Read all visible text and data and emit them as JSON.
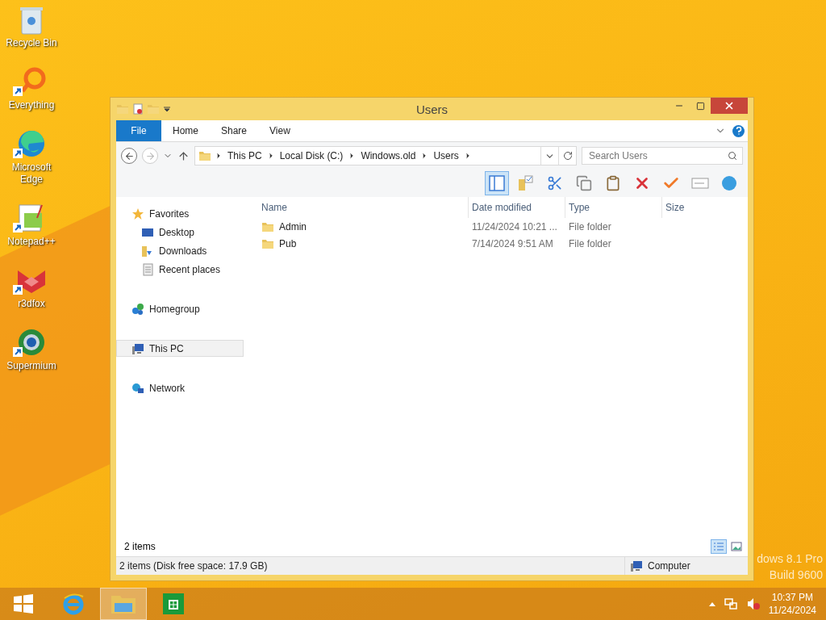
{
  "desktop_icons": [
    {
      "label": "Recycle Bin",
      "kind": "recycle",
      "shortcut": false
    },
    {
      "label": "Everything",
      "kind": "everything",
      "shortcut": true
    },
    {
      "label": "Microsoft Edge",
      "kind": "edge",
      "shortcut": true
    },
    {
      "label": "Notepad++",
      "kind": "notepad",
      "shortcut": true
    },
    {
      "label": "r3dfox",
      "kind": "fox",
      "shortcut": true
    },
    {
      "label": "Supermium",
      "kind": "supermium",
      "shortcut": true
    }
  ],
  "watermark": [
    "dows 8.1 Pro",
    "Build 9600"
  ],
  "window": {
    "title": "Users",
    "ribbon_tabs": [
      {
        "label": "File",
        "kind": "file",
        "selected": false
      },
      {
        "label": "Home",
        "kind": "tab",
        "selected": false
      },
      {
        "label": "Share",
        "kind": "tab",
        "selected": false
      },
      {
        "label": "View",
        "kind": "tab",
        "selected": false
      }
    ],
    "address": {
      "segments": [
        "This PC",
        "Local Disk (C:)",
        "Windows.old",
        "Users"
      ],
      "search_placeholder": "Search Users"
    },
    "toolbar": [
      {
        "kind": "pane",
        "selected": true
      },
      {
        "kind": "folder-check",
        "selected": false
      },
      {
        "kind": "cut",
        "selected": false
      },
      {
        "kind": "copy",
        "selected": false
      },
      {
        "kind": "paste",
        "selected": false
      },
      {
        "kind": "delete",
        "selected": false
      },
      {
        "kind": "check",
        "selected": false
      },
      {
        "kind": "rename",
        "selected": false
      },
      {
        "kind": "globe",
        "selected": false
      }
    ],
    "nav": [
      {
        "label": "Favorites",
        "kind": "star",
        "selected": false,
        "children": [
          {
            "label": "Desktop",
            "kind": "desktop",
            "selected": false
          },
          {
            "label": "Downloads",
            "kind": "downloads",
            "selected": false
          },
          {
            "label": "Recent places",
            "kind": "recent",
            "selected": false
          }
        ]
      },
      {
        "label": "Homegroup",
        "kind": "homegroup",
        "selected": false
      },
      {
        "label": "This PC",
        "kind": "pc",
        "selected": true
      },
      {
        "label": "Network",
        "kind": "network",
        "selected": false
      }
    ],
    "columns": [
      "Name",
      "Date modified",
      "Type",
      "Size"
    ],
    "files": [
      {
        "name": "Admin",
        "date_modified": "11/24/2024 10:21 ...",
        "type": "File folder"
      },
      {
        "name": "Pub",
        "date_modified": "7/14/2024 9:51 AM",
        "type": "File folder"
      }
    ],
    "item_count": "2 items",
    "status_bar": {
      "text": "2 items (Disk free space: 17.9 GB)",
      "location": "Computer"
    }
  },
  "taskbar": {
    "apps": [
      {
        "kind": "ie",
        "active": false
      },
      {
        "kind": "explorer",
        "active": true
      },
      {
        "kind": "store",
        "active": false
      }
    ],
    "time": "10:37 PM",
    "date": "11/24/2024"
  }
}
